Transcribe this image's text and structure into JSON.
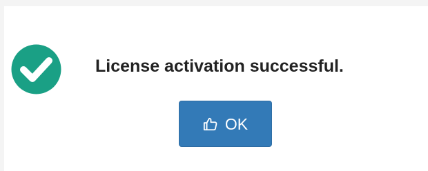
{
  "dialog": {
    "message": "License activation successful.",
    "icon": "check-circle-icon",
    "ok_button": {
      "label": "OK",
      "icon": "thumbs-up-icon"
    }
  },
  "colors": {
    "success": "#1aa085",
    "button_primary": "#337ab7",
    "text": "#222222"
  }
}
